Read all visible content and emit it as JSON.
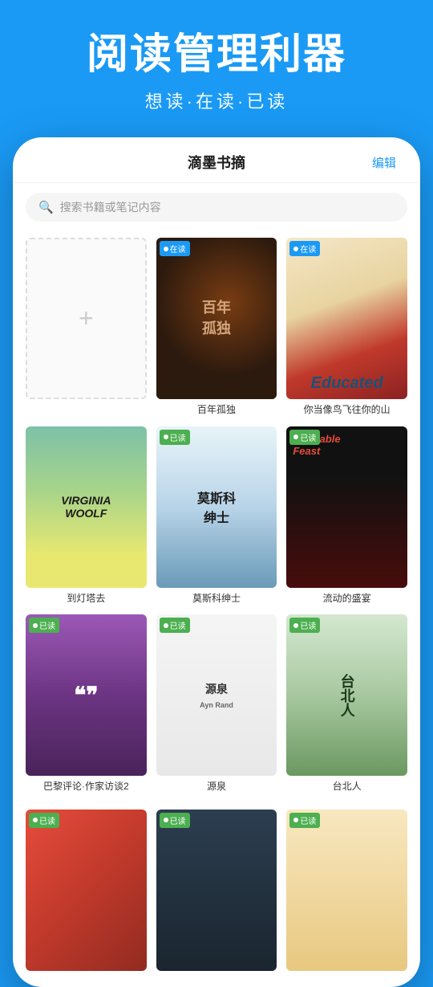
{
  "hero": {
    "title": "阅读管理利器",
    "subtitle": "想读·在读·已读"
  },
  "app": {
    "header_title": "滴墨书摘",
    "edit_label": "编辑"
  },
  "search": {
    "placeholder": "搜索书籍或笔记内容"
  },
  "books": [
    {
      "id": "add",
      "title": "",
      "type": "add"
    },
    {
      "id": "bainian",
      "title": "百年孤独",
      "status": "在读",
      "status_type": "reading"
    },
    {
      "id": "educated",
      "title": "你当像鸟飞往你的山",
      "status": "在读",
      "status_type": "reading"
    },
    {
      "id": "virginia",
      "title": "到灯塔去",
      "status": "",
      "status_type": "none"
    },
    {
      "id": "msk",
      "title": "莫斯科绅士",
      "status": "已读",
      "status_type": "read"
    },
    {
      "id": "moveable",
      "title": "流动的盛宴",
      "status": "已读",
      "status_type": "read"
    },
    {
      "id": "bali",
      "title": "巴黎评论·作家访谈2",
      "status": "已读",
      "status_type": "read"
    },
    {
      "id": "yuanquan",
      "title": "源泉",
      "status": "已读",
      "status_type": "read"
    },
    {
      "id": "taipei",
      "title": "台北人",
      "status": "已读",
      "status_type": "read"
    }
  ],
  "bottom_books": [
    {
      "id": "b1",
      "status": "已读",
      "status_type": "read"
    },
    {
      "id": "b2",
      "status": "已读",
      "status_type": "read"
    },
    {
      "id": "b3",
      "status": "已读",
      "status_type": "read"
    }
  ],
  "colors": {
    "primary": "#1a9af5",
    "read_badge": "#4caf50",
    "reading_badge": "#1a9af5"
  }
}
